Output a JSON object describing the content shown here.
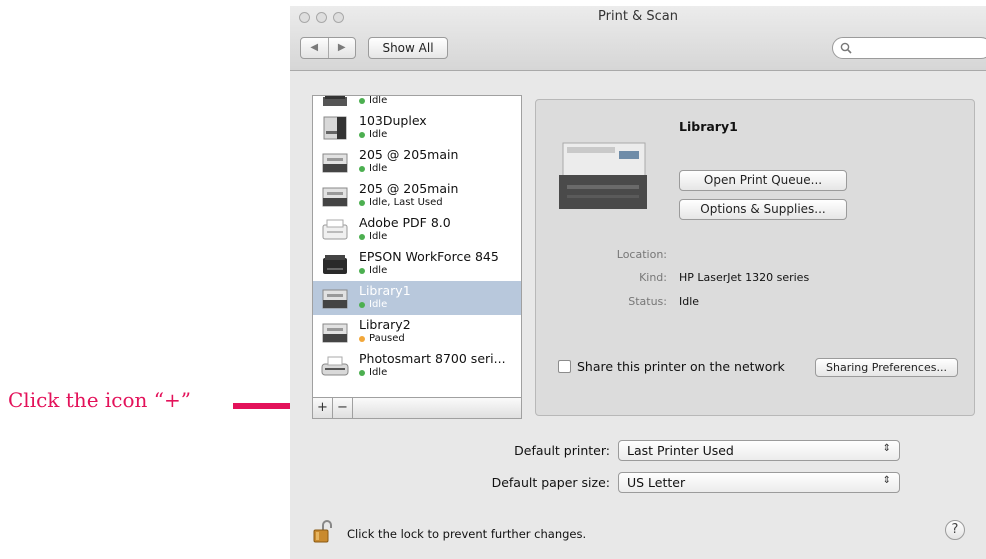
{
  "annotation": {
    "text": "Click the icon “+”"
  },
  "window": {
    "title": "Print & Scan",
    "back_label": "◀",
    "forward_label": "▶",
    "show_all_label": "Show All",
    "search_placeholder": ""
  },
  "printers": [
    {
      "name": "",
      "status": "Idle",
      "status_color": "#4caf50"
    },
    {
      "name": "103Duplex",
      "status": "Idle",
      "status_color": "#4caf50"
    },
    {
      "name": "205 @ 205main",
      "status": "Idle",
      "status_color": "#4caf50"
    },
    {
      "name": "205 @ 205main",
      "status": "Idle, Last Used",
      "status_color": "#4caf50"
    },
    {
      "name": "Adobe PDF 8.0",
      "status": "Idle",
      "status_color": "#4caf50"
    },
    {
      "name": "EPSON WorkForce 845",
      "status": "Idle",
      "status_color": "#4caf50"
    },
    {
      "name": "Library1",
      "status": "Idle",
      "status_color": "#4caf50",
      "selected": true
    },
    {
      "name": "Library2",
      "status": "Paused",
      "status_color": "#f2a73a"
    },
    {
      "name": "Photosmart 8700 seri...",
      "status": "Idle",
      "status_color": "#4caf50"
    }
  ],
  "list_controls": {
    "add_label": "+",
    "remove_label": "−"
  },
  "detail": {
    "printer_name": "Library1",
    "open_queue_label": "Open Print Queue...",
    "options_label": "Options & Supplies...",
    "location_label": "Location:",
    "location_value": "",
    "kind_label": "Kind:",
    "kind_value": "HP LaserJet 1320 series",
    "status_label": "Status:",
    "status_value": "Idle",
    "share_label": "Share this printer on the network",
    "share_checked": false,
    "sharing_prefs_label": "Sharing Preferences..."
  },
  "defaults": {
    "printer_label": "Default printer:",
    "printer_value": "Last Printer Used",
    "paper_label": "Default paper size:",
    "paper_value": "US Letter"
  },
  "footer": {
    "lock_text": "Click the lock to prevent further changes.",
    "help_label": "?"
  },
  "colors": {
    "annotation": "#e3125a",
    "selection": "#b8c8dc",
    "idle": "#4caf50",
    "paused": "#f2a73a"
  }
}
